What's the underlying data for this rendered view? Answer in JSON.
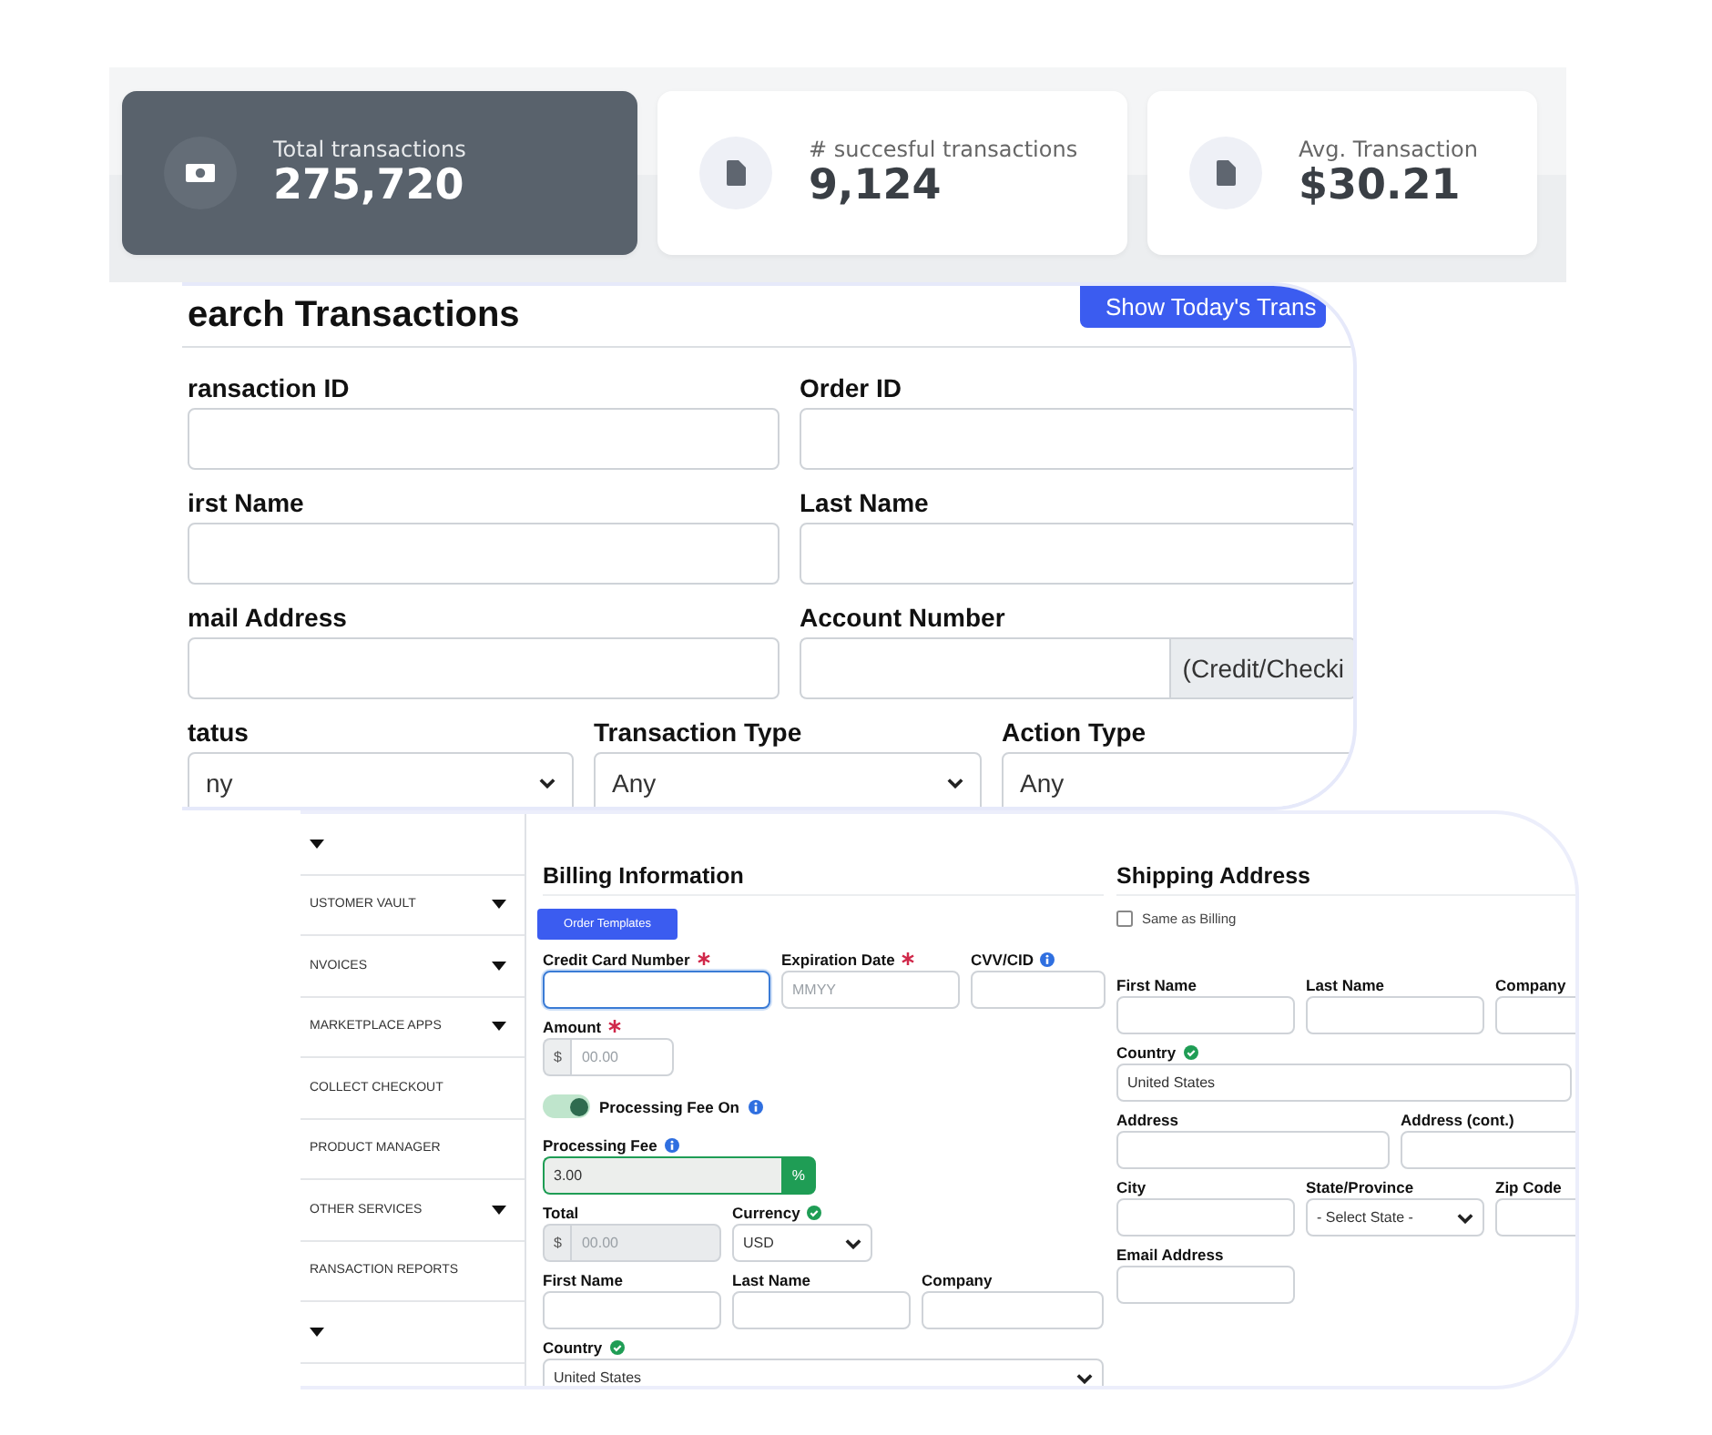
{
  "stats": [
    {
      "kind": "cash",
      "label": "Total transactions",
      "value": "275,720",
      "selected": true
    },
    {
      "kind": "document",
      "label": "# succesful transactions",
      "value": "9,124",
      "selected": false
    },
    {
      "kind": "document",
      "label": "Avg. Transaction",
      "value": "$30.21",
      "selected": false
    }
  ],
  "search": {
    "title": "earch Transactions",
    "button": "Show Today's Trans",
    "rows": [
      [
        {
          "label": "ransaction ID",
          "kind": "text"
        },
        {
          "label": "Order ID",
          "kind": "text"
        }
      ],
      [
        {
          "label": "irst Name",
          "kind": "text"
        },
        {
          "label": "Last Name",
          "kind": "text"
        }
      ],
      [
        {
          "label": "mail Address",
          "kind": "text"
        },
        {
          "label": "Account Number",
          "kind": "addon",
          "addon": "(Credit/Checki"
        }
      ],
      [
        {
          "label": "tatus",
          "kind": "select",
          "value": "ny",
          "caret": true
        },
        {
          "label": "Transaction Type",
          "kind": "select",
          "value": "Any",
          "caret": true
        },
        {
          "label": "Action Type",
          "kind": "select",
          "value": "Any"
        }
      ]
    ]
  },
  "billing": {
    "sidebar": [
      {
        "expandable": true
      },
      {
        "label": "USTOMER VAULT",
        "expandable": true
      },
      {
        "label": "NVOICES",
        "expandable": true
      },
      {
        "label": "MARKETPLACE APPS",
        "expandable": true
      },
      {
        "label": "COLLECT CHECKOUT",
        "expandable": false
      },
      {
        "label": "PRODUCT MANAGER",
        "expandable": false
      },
      {
        "label": "OTHER SERVICES",
        "expandable": true
      },
      {
        "label": "RANSACTION REPORTS",
        "expandable": false
      },
      {
        "expandable": true
      }
    ],
    "title": "Billing Information",
    "button": "Order Templates",
    "items": [
      {
        "kind": "fields",
        "fields": [
          {
            "label": "Credit Card Number",
            "required": true,
            "kind": "text",
            "focused": true
          },
          {
            "label": "Expiration Date",
            "required": true,
            "kind": "text",
            "placeholder": "MMYY",
            "focused": false
          },
          {
            "label": "CVV/CID",
            "info": true,
            "kind": "text"
          }
        ]
      },
      {
        "kind": "fields",
        "fields": [
          {
            "label": "Amount",
            "required": true,
            "kind": "prefix",
            "prefix": "$",
            "placeholder": "00.00",
            "disabled": false
          }
        ]
      },
      {
        "kind": "toggle",
        "label": "Processing Fee On",
        "on": true,
        "info": true
      },
      {
        "kind": "fields",
        "fields": [
          {
            "label": "Processing Fee",
            "info": true,
            "kind": "suffix",
            "value": "3.00",
            "suffix": "%"
          }
        ]
      },
      {
        "kind": "fields",
        "fields": [
          {
            "label": "Total",
            "kind": "prefix",
            "prefix": "$",
            "placeholder": "00.00",
            "disabled": true
          },
          {
            "label": "Currency",
            "verified": true,
            "kind": "select",
            "value": "USD",
            "caret": true
          }
        ]
      },
      {
        "kind": "fields",
        "fields": [
          {
            "label": "First Name",
            "kind": "text"
          },
          {
            "label": "Last Name",
            "kind": "text"
          },
          {
            "label": "Company",
            "kind": "text"
          }
        ]
      },
      {
        "kind": "fields",
        "fields": [
          {
            "label": "Country",
            "verified": true,
            "kind": "select",
            "value": "United States",
            "caret": true
          }
        ]
      }
    ]
  },
  "shipping": {
    "title": "Shipping Address",
    "checkbox": {
      "label": "Same as Billing",
      "checked": false
    },
    "rows": [
      [
        {
          "label": "First Name",
          "kind": "text"
        },
        {
          "label": "Last Name",
          "kind": "text"
        },
        {
          "label": "Company",
          "kind": "text"
        }
      ],
      [
        {
          "label": "Country",
          "verified": true,
          "kind": "text",
          "value": "United States"
        }
      ],
      [
        {
          "label": "Address",
          "kind": "text"
        },
        {
          "label": "Address (cont.)",
          "kind": "text"
        }
      ],
      [
        {
          "label": "City",
          "kind": "text"
        },
        {
          "label": "State/Province",
          "kind": "select",
          "value": "- Select State -",
          "caret": true
        },
        {
          "label": "Zip Code",
          "kind": "text"
        }
      ],
      [
        {
          "label": "Email Address",
          "kind": "text"
        }
      ]
    ]
  }
}
